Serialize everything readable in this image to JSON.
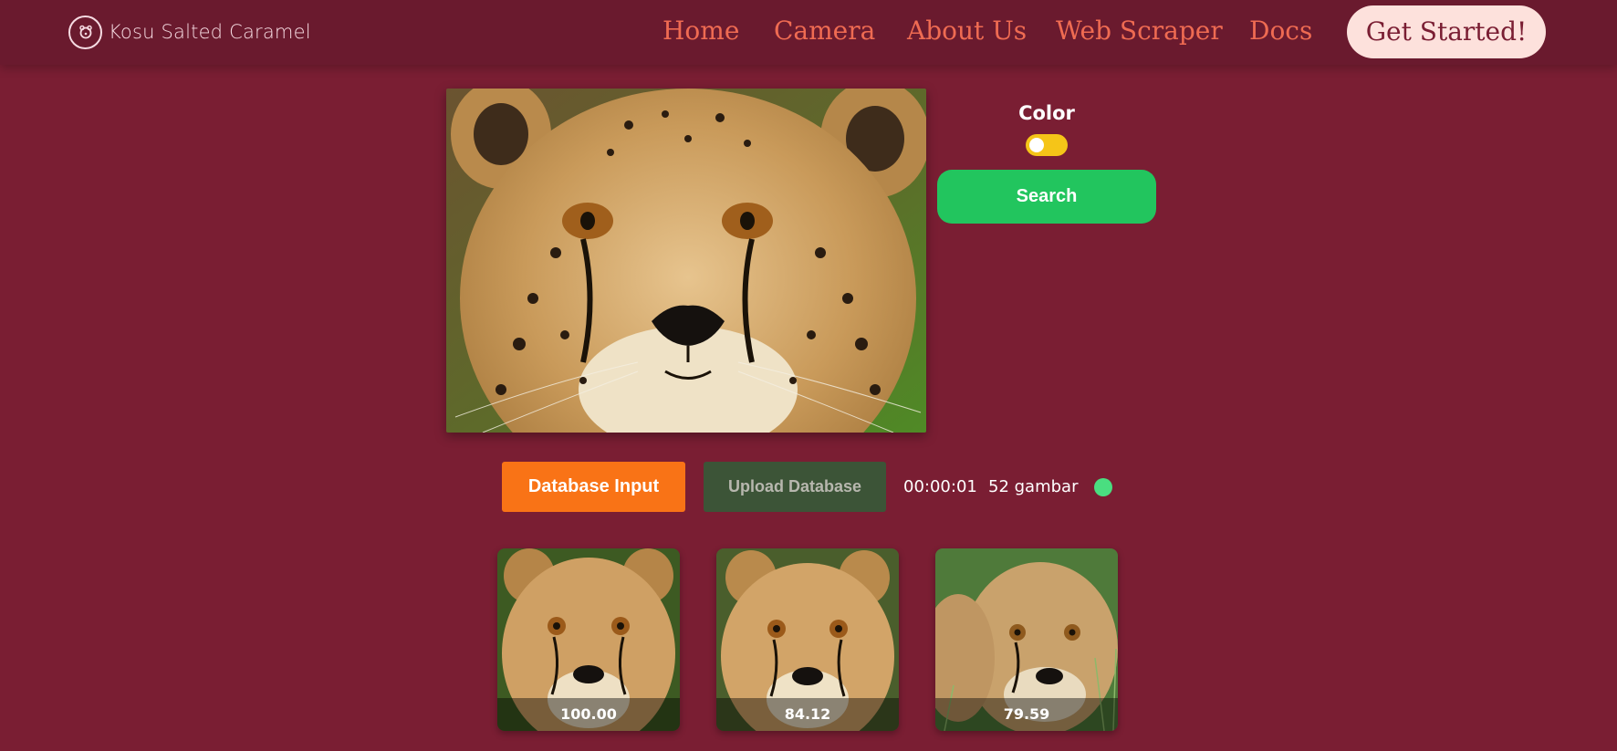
{
  "nav": {
    "brand": "Kosu Salted Caramel",
    "brand_icon": "bear-logo-icon",
    "links": [
      "Home",
      "Camera",
      "About Us",
      "Web Scraper",
      "Docs"
    ],
    "cta": "Get Started!"
  },
  "search_panel": {
    "color_label": "Color",
    "color_toggle_on": false,
    "search_button": "Search"
  },
  "database": {
    "input_button": "Database Input",
    "upload_button": "Upload Database",
    "elapsed": "00:00:01",
    "image_count": "52 gambar",
    "status_color": "#4ade80"
  },
  "results": [
    {
      "score": "100.00"
    },
    {
      "score": "84.12"
    },
    {
      "score": "79.59"
    }
  ],
  "colors": {
    "background": "#7a1e33",
    "navbar": "#6a1a2e",
    "nav_link": "#ef6b52",
    "cta_bg": "#fde1dc",
    "search_button": "#22c55e",
    "database_input": "#f97316",
    "upload_database": "#3c5437",
    "toggle": "#f5c518"
  }
}
